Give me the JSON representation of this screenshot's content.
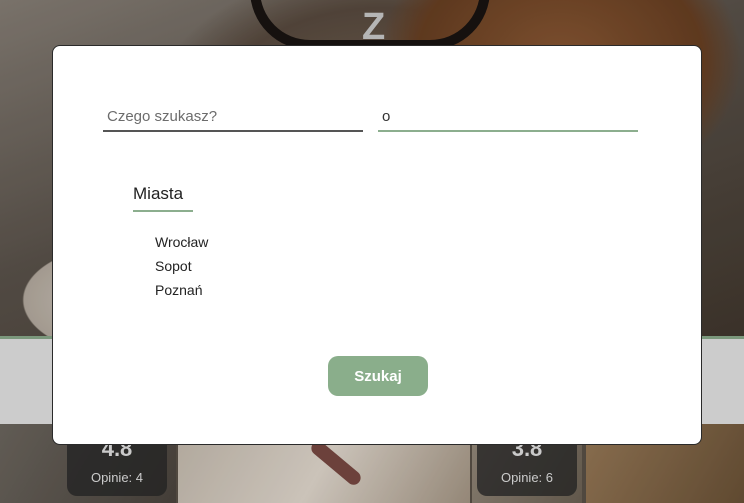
{
  "hero": {
    "letter": "Z"
  },
  "search_modal": {
    "what_placeholder": "Czego szukasz?",
    "where_value": "o",
    "suggestions": {
      "heading": "Miasta",
      "items": [
        "Wrocław",
        "Sopot",
        "Poznań"
      ]
    },
    "submit_label": "Szukaj"
  },
  "cards": [
    {
      "rating": "4.8",
      "reviews": "Opinie: 4"
    },
    {
      "rating": "3.8",
      "reviews": "Opinie: 6"
    }
  ],
  "colors": {
    "accent": "#8aae8b",
    "modal_bg": "#ffffff"
  }
}
